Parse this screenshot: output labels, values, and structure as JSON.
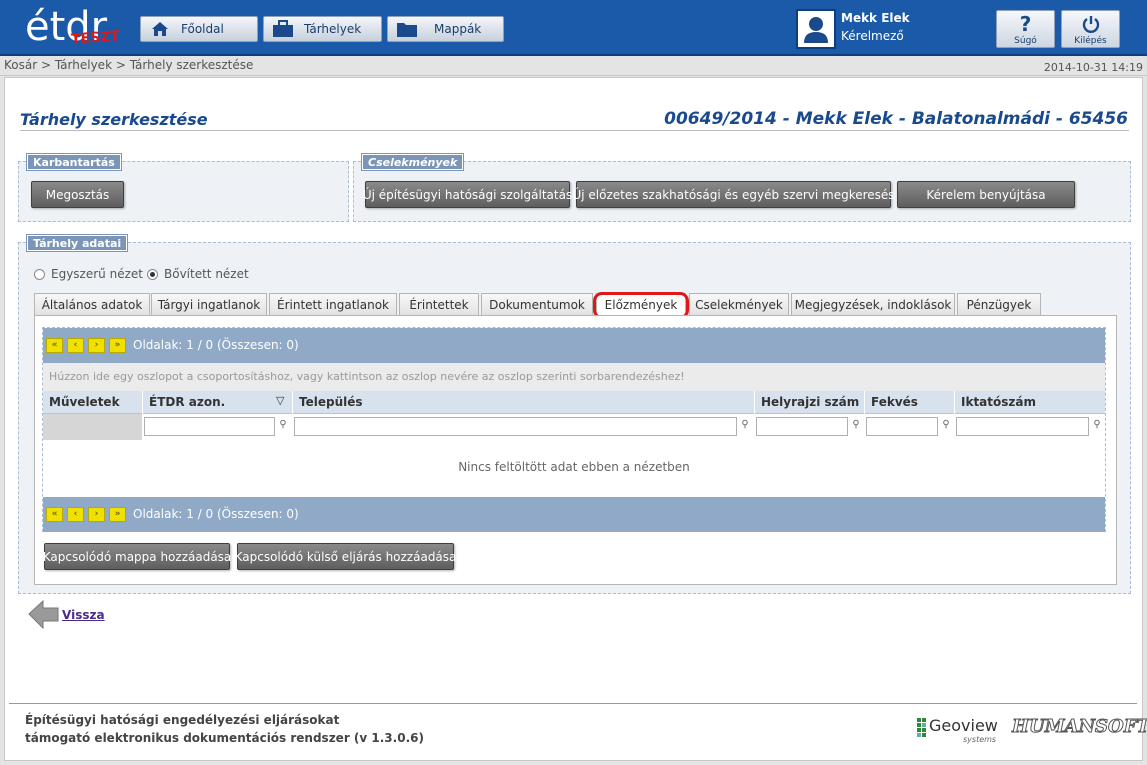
{
  "header": {
    "logo_text": "TESZT",
    "nav": [
      {
        "label": "Főoldal",
        "icon": "home-icon"
      },
      {
        "label": "Tárhelyek",
        "icon": "briefcase-icon"
      },
      {
        "label": "Mappák",
        "icon": "folder-icon"
      }
    ],
    "user": {
      "name": "Mekk Elek",
      "role": "Kérelmező"
    },
    "help_label": "Súgó",
    "logout_label": "Kilépés"
  },
  "breadcrumb": "Kosár > Tárhelyek > Tárhely szerkesztése",
  "datetime": "2014-10-31 14:19",
  "page": {
    "title": "Tárhely szerkesztése",
    "case": "00649/2014 - Mekk Elek - Balatonalmádi - 65456"
  },
  "maintenance": {
    "legend": "Karbantartás",
    "share_label": "Megosztás"
  },
  "actions": {
    "legend": "Cselekmények",
    "buttons": [
      "Új építésügyi hatósági szolgáltatás",
      "Új előzetes szakhatósági és egyéb szervi megkeresés",
      "Kérelem benyújtása"
    ]
  },
  "storage": {
    "legend": "Tárhely adatai",
    "view_simple": "Egyszerű nézet",
    "view_extended": "Bővített nézet",
    "tabs": [
      "Általános adatok",
      "Tárgyi ingatlanok",
      "Érintett ingatlanok",
      "Érintettek",
      "Dokumentumok",
      "Előzmények",
      "Cselekmények",
      "Megjegyzések, indoklások",
      "Pénzügyek"
    ],
    "active_tab": "Előzmények"
  },
  "grid": {
    "pager_text": "Oldalak: 1 / 0 (Összesen: 0)",
    "pager_buttons": [
      "«",
      "‹",
      "›",
      "»"
    ],
    "group_hint": "Húzzon ide egy oszlopot a csoportosításhoz, vagy kattintson az oszlop nevére az oszlop szerinti sorbarendezéshez!",
    "columns": [
      "Műveletek",
      "ÉTDR azon.",
      "Település",
      "Helyrajzi szám",
      "Fekvés",
      "Iktatószám"
    ],
    "sort_indicator": "▽",
    "empty_text": "Nincs feltöltött adat ebben a nézetben"
  },
  "bottom_buttons": [
    "Kapcsolódó mappa hozzáadása",
    "Kapcsolódó külső eljárás hozzáadása"
  ],
  "back_label": "Vissza",
  "footer": {
    "line1": "Építésügyi hatósági engedélyezési eljárásokat",
    "line2": "támogató elektronikus dokumentációs rendszer (v 1.3.0.6)",
    "logo1": "Geoview",
    "logo1_sub": "systems",
    "logo2": "HUMANSOFT"
  }
}
